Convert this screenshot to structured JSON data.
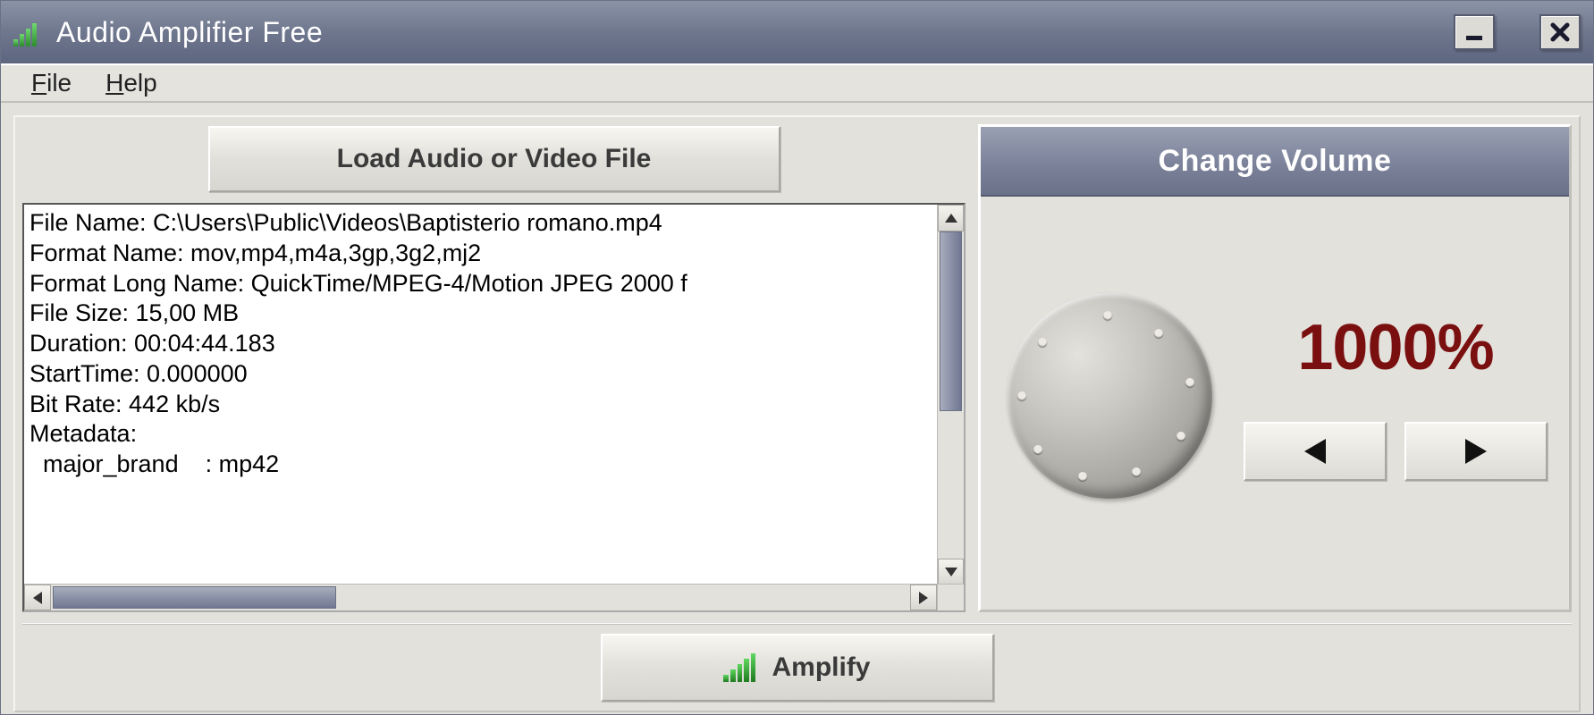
{
  "window": {
    "title": "Audio Amplifier Free"
  },
  "menu": {
    "file": "File",
    "help": "Help"
  },
  "buttons": {
    "load": "Load Audio or Video File",
    "amplify": "Amplify"
  },
  "info": {
    "lines": "File Name: C:\\Users\\Public\\Videos\\Baptisterio romano.mp4\nFormat Name: mov,mp4,m4a,3gp,3g2,mj2\nFormat Long Name: QuickTime/MPEG-4/Motion JPEG 2000 f\nFile Size: 15,00 MB\nDuration: 00:04:44.183\nStartTime: 0.000000\nBit Rate: 442 kb/s\nMetadata:\n  major_brand    : mp42"
  },
  "volume": {
    "header": "Change Volume",
    "value": "1000%"
  }
}
